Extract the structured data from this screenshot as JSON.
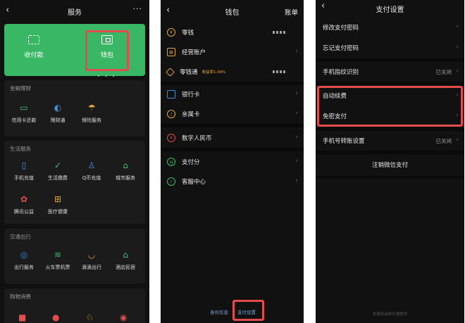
{
  "services": {
    "title": "服务",
    "more": "···",
    "top": {
      "pay_label": "收付款",
      "wallet_label": "钱包",
      "wallet_dots": "• • •"
    },
    "sections": [
      {
        "title": "金融理财",
        "items": [
          "信用卡还款",
          "理财通",
          "保险服务"
        ]
      },
      {
        "title": "生活服务",
        "items": [
          "手机充值",
          "生活缴费",
          "Q币充值",
          "城市服务",
          "腾讯公益",
          "医疗健康"
        ]
      },
      {
        "title": "交通出行",
        "items": [
          "出行服务",
          "火车票机票",
          "滴滴出行",
          "酒店民宿"
        ]
      },
      {
        "title": "购物消费",
        "items": []
      }
    ]
  },
  "wallet": {
    "title": "钱包",
    "right": "账单",
    "rows": [
      "零钱",
      "经营账户",
      "零钱通",
      "银行卡",
      "亲属卡",
      "数字人民币",
      "支付分",
      "客服中心"
    ],
    "lingqiantong_badge": "收益率1.09%",
    "footer": {
      "identity": "身份信息",
      "pay_settings": "支付设置"
    }
  },
  "paysettings": {
    "title": "支付设置",
    "rows": [
      "修改支付密码",
      "忘记支付密码",
      "手机指纹识别",
      "自动续费",
      "免密支付",
      "手机号转账设置"
    ],
    "fingerprint_status": "已关闭",
    "transfer_status": "已关闭",
    "cancel": "注销微信支付",
    "footer_note": "本服务由财付通提供"
  },
  "colors": {
    "accent_green": "#39b764",
    "highlight_red": "#e24c4c",
    "bg_dark": "#111111"
  }
}
